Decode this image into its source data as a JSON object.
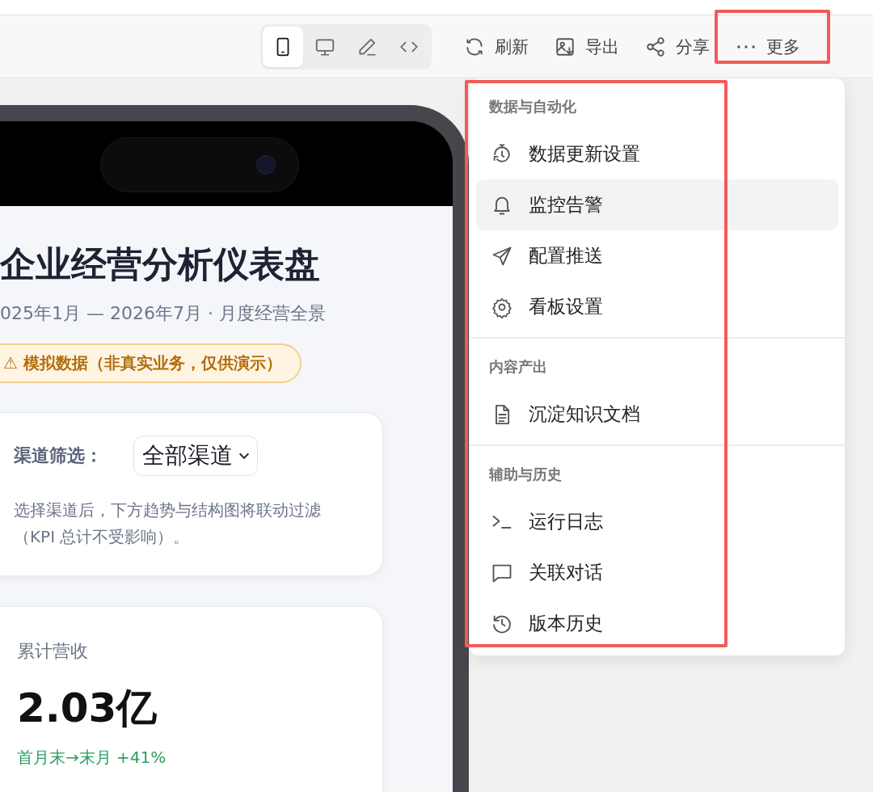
{
  "view_modes": [
    {
      "kind": "mobile",
      "selected": true
    },
    {
      "kind": "desktop",
      "selected": false
    },
    {
      "kind": "edit",
      "selected": false
    },
    {
      "kind": "code",
      "selected": false
    }
  ],
  "actions": [
    {
      "kind": "refresh",
      "label": "刷新",
      "highlighted": false
    },
    {
      "kind": "export",
      "label": "导出",
      "highlighted": false
    },
    {
      "kind": "share",
      "label": "分享",
      "highlighted": false
    },
    {
      "kind": "more",
      "label": "更多",
      "highlighted": true
    }
  ],
  "preview": {
    "title": "企业经营分析仪表盘",
    "subtitle": "025年1月 — 2026年7月 · 月度经营全景",
    "badge": "⚠ 模拟数据（非真实业务，仅供演示）",
    "filter": {
      "label": "渠道筛选：",
      "value": "全部渠道",
      "hint": "选择渠道后，下方趋势与结构图将联动过滤（KPI 总计不受影响）。"
    },
    "kpi": {
      "label": "累计营收",
      "value": "2.03亿",
      "change": "首月末→末月 +41%"
    }
  },
  "menu": {
    "highlighted": true,
    "sections": [
      {
        "title": "数据与自动化",
        "items": [
          {
            "kind": "timer",
            "label": "数据更新设置",
            "selected": false
          },
          {
            "kind": "bell",
            "label": "监控告警",
            "selected": true
          },
          {
            "kind": "send",
            "label": "配置推送",
            "selected": false
          },
          {
            "kind": "gear",
            "label": "看板设置",
            "selected": false
          }
        ]
      },
      {
        "title": "内容产出",
        "items": [
          {
            "kind": "doc",
            "label": "沉淀知识文档",
            "selected": false
          }
        ]
      },
      {
        "title": "辅助与历史",
        "items": [
          {
            "kind": "terminal",
            "label": "运行日志",
            "selected": false
          },
          {
            "kind": "chat",
            "label": "关联对话",
            "selected": false
          },
          {
            "kind": "history",
            "label": "版本历史",
            "selected": false
          }
        ]
      }
    ]
  }
}
